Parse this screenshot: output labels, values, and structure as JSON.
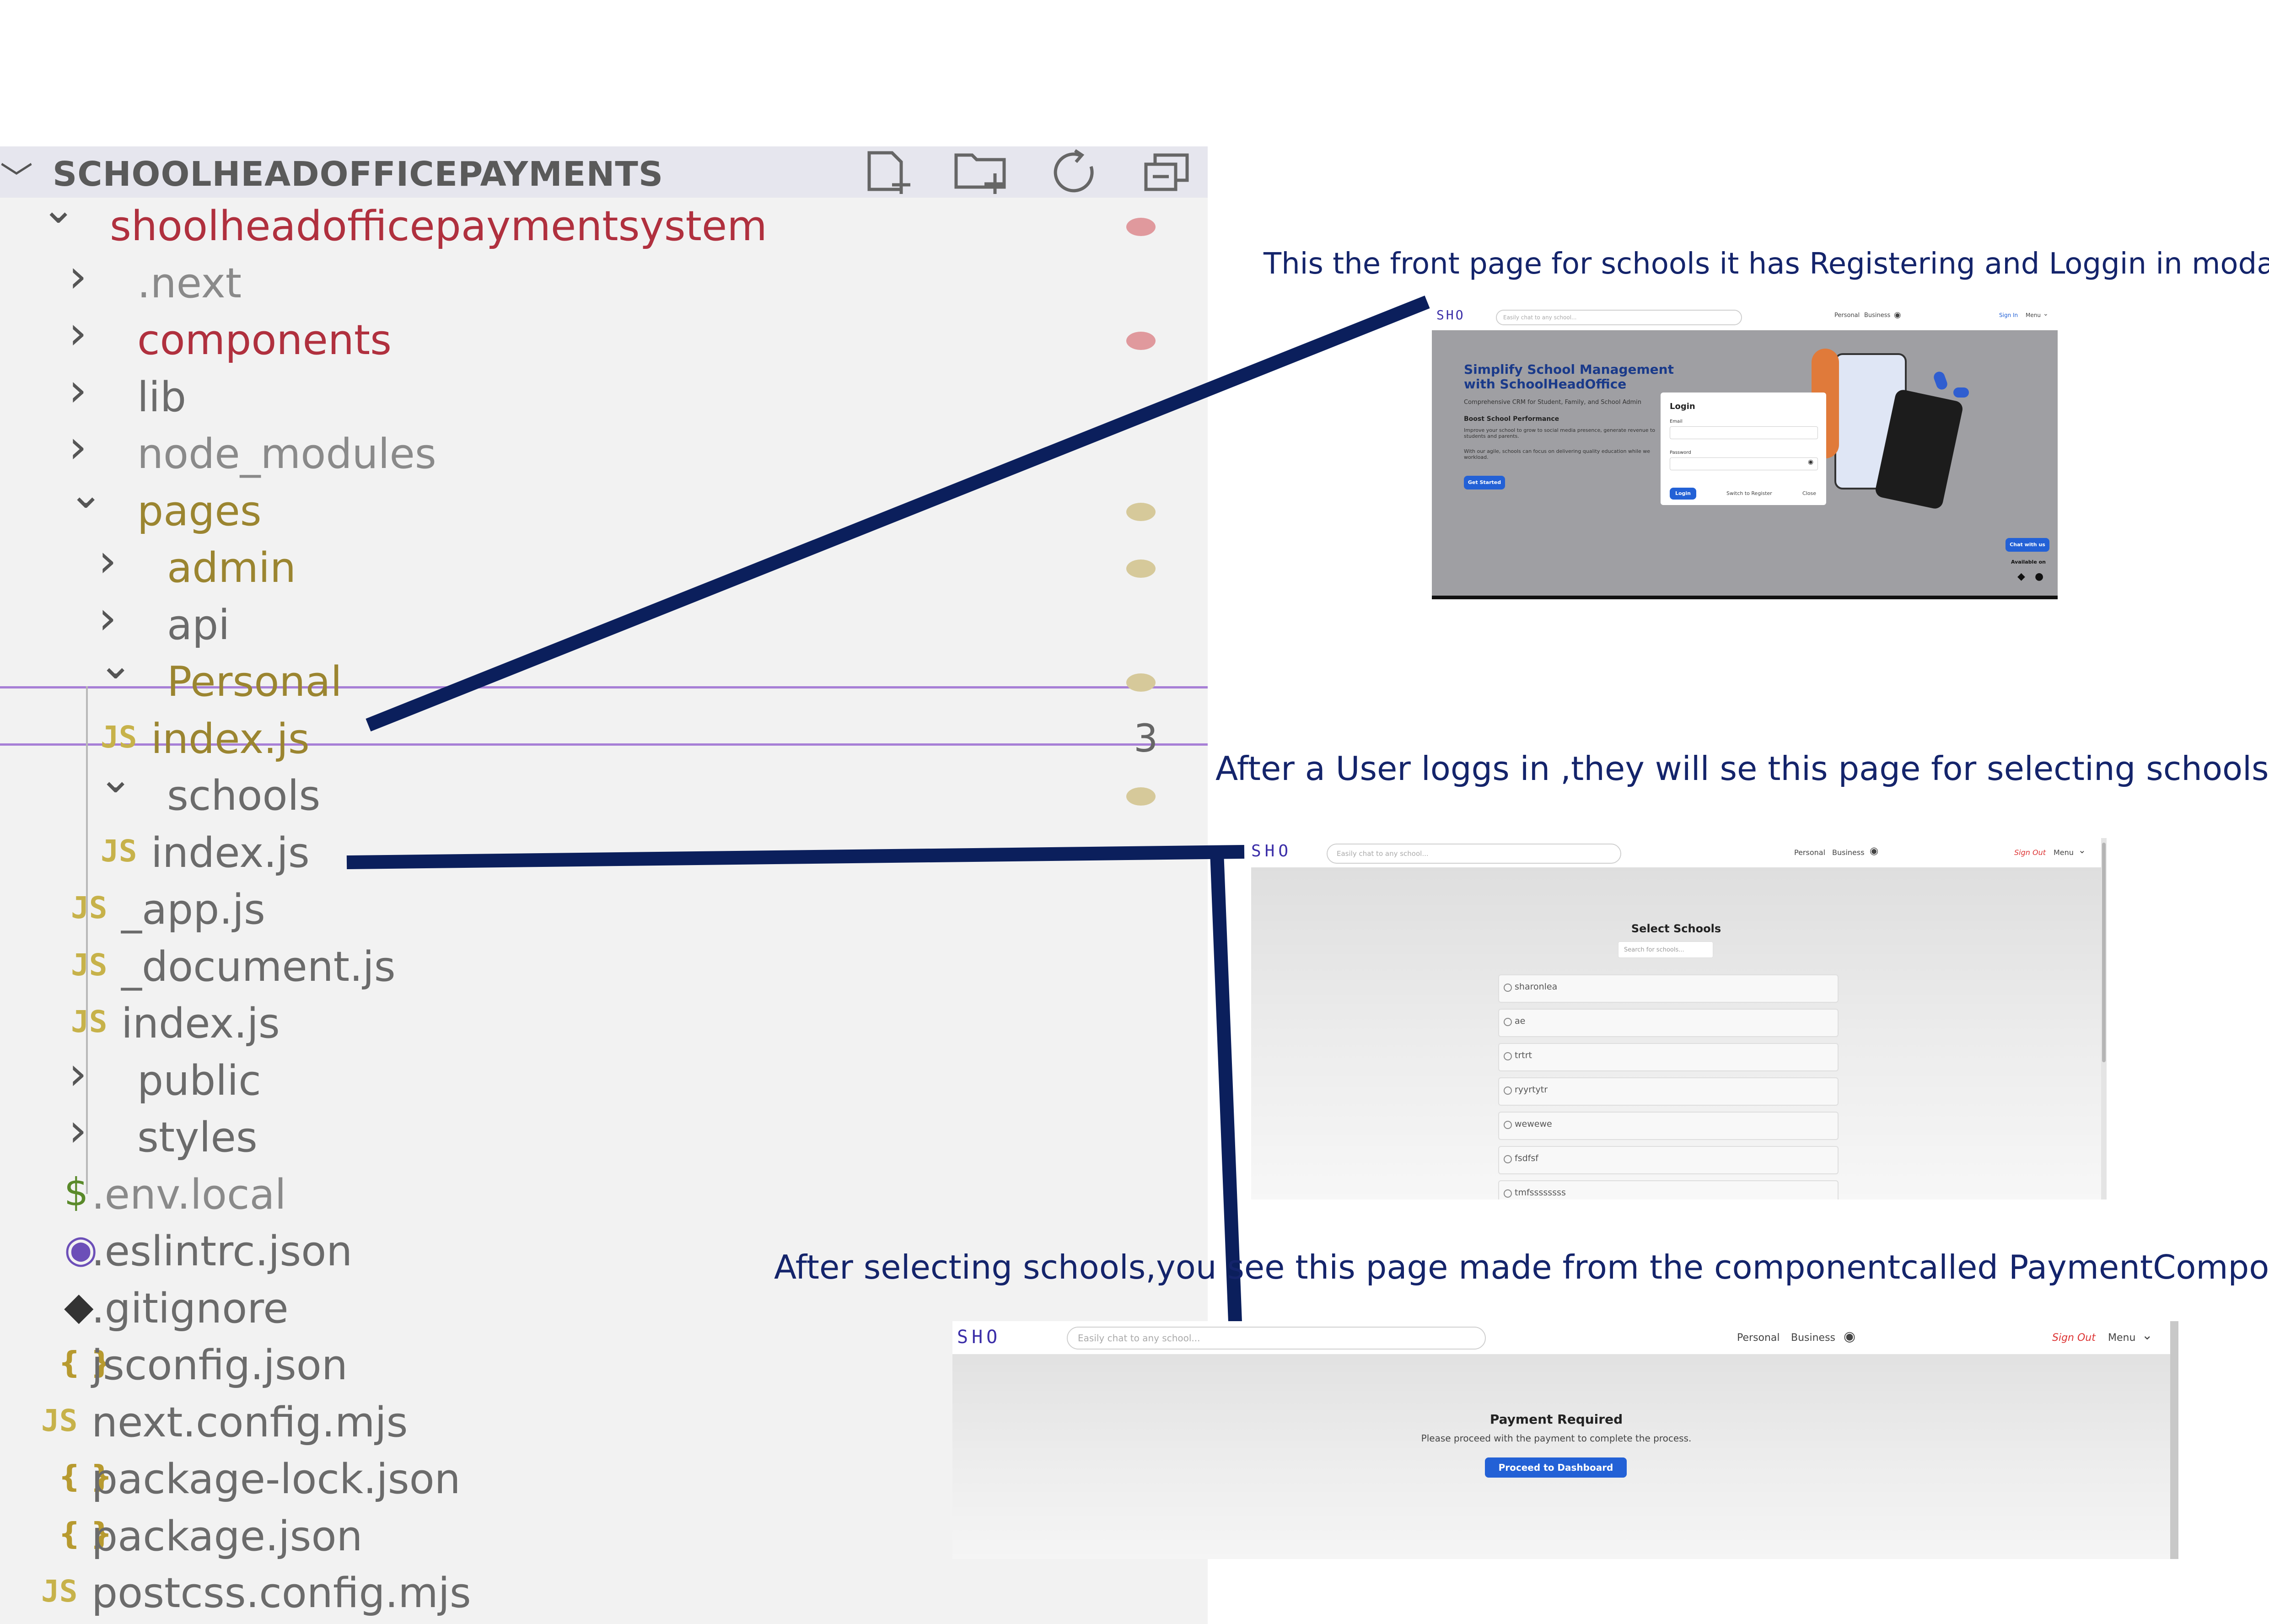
{
  "explorer": {
    "title": "SCHOOLHEADOFFICEPAYMENTS",
    "header_icons": [
      "new-file-icon",
      "new-folder-icon",
      "refresh-icon",
      "collapse-all-icon"
    ],
    "items": [
      {
        "label": "shoolheadofficepaymentsystem",
        "type": "folder",
        "expanded": true,
        "depth": 1,
        "color": "#b0303e",
        "dot": "#e0999d"
      },
      {
        "label": ".next",
        "type": "folder",
        "expanded": false,
        "depth": 2,
        "color": "#8a8a8a"
      },
      {
        "label": "components",
        "type": "folder",
        "expanded": false,
        "depth": 2,
        "color": "#b0303e",
        "dot": "#e0999d"
      },
      {
        "label": "lib",
        "type": "folder",
        "expanded": false,
        "depth": 2,
        "color": "#6b6b6b"
      },
      {
        "label": "node_modules",
        "type": "folder",
        "expanded": false,
        "depth": 2,
        "color": "#8a8a8a"
      },
      {
        "label": "pages",
        "type": "folder",
        "expanded": true,
        "depth": 2,
        "color": "#9b8530",
        "dot": "#d6c99a"
      },
      {
        "label": "admin",
        "type": "folder",
        "expanded": false,
        "depth": 3,
        "color": "#9b8530",
        "dot": "#d6c99a"
      },
      {
        "label": "api",
        "type": "folder",
        "expanded": false,
        "depth": 3,
        "color": "#6b6b6b"
      },
      {
        "label": "Personal",
        "type": "folder",
        "expanded": true,
        "depth": 3,
        "color": "#9b8530",
        "dot": "#d6c99a"
      },
      {
        "label": "index.js",
        "type": "js",
        "depth": 4,
        "color": "#9b8530",
        "count": "3"
      },
      {
        "label": "schools",
        "type": "folder",
        "expanded": true,
        "depth": 3,
        "color": "#6b6b6b",
        "dot": "#d6c99a"
      },
      {
        "label": "index.js",
        "type": "js",
        "depth": 4,
        "color": "#6b6b6b"
      },
      {
        "label": "_app.js",
        "type": "js",
        "depth": 3,
        "color": "#6b6b6b"
      },
      {
        "label": "_document.js",
        "type": "js",
        "depth": 3,
        "color": "#6b6b6b"
      },
      {
        "label": "index.js",
        "type": "js",
        "depth": 3,
        "color": "#6b6b6b"
      },
      {
        "label": "public",
        "type": "folder",
        "expanded": false,
        "depth": 2,
        "color": "#6b6b6b"
      },
      {
        "label": "styles",
        "type": "folder",
        "expanded": false,
        "depth": 2,
        "color": "#6b6b6b"
      },
      {
        "label": ".env.local",
        "type": "env",
        "depth": 2,
        "color": "#8a8a8a"
      },
      {
        "label": ".eslintrc.json",
        "type": "eslint",
        "depth": 2,
        "color": "#6b6b6b"
      },
      {
        "label": ".gitignore",
        "type": "git",
        "depth": 2,
        "color": "#6b6b6b"
      },
      {
        "label": "jsconfig.json",
        "type": "json",
        "depth": 2,
        "color": "#6b6b6b"
      },
      {
        "label": "next.config.mjs",
        "type": "js",
        "depth": 2,
        "color": "#6b6b6b"
      },
      {
        "label": "package-lock.json",
        "type": "json",
        "depth": 2,
        "color": "#6b6b6b"
      },
      {
        "label": "package.json",
        "type": "json",
        "depth": 2,
        "color": "#6b6b6b"
      },
      {
        "label": "postcss.config.mjs",
        "type": "js",
        "depth": 2,
        "color": "#6b6b6b"
      }
    ]
  },
  "annotations": {
    "front_page": "This the front page for schools it has Registering and Loggin in modal",
    "select_schools": "After a User loggs in ,they will se this page for selecting schools",
    "payment": "After selecting schools,you see this page made from the componentcalled PaymentComponent"
  },
  "screenshot1": {
    "logo": "SHO",
    "search_placeholder": "Easily chat to any school...",
    "nav": [
      "Personal",
      "Business"
    ],
    "sign_in": "Sign In",
    "menu": "Menu",
    "hero_title": "Simplify School Management with SchoolHeadOffice",
    "hero_sub": "Comprehensive CRM for Student, Family, and School Admin",
    "boost_title": "Boost School Performance",
    "boost_text_1": "Improve your school to grow to social media presence, generate revenue to students and parents.",
    "boost_text_2": "With our agile, schools can focus on delivering quality education while we workload.",
    "get_started": "Get Started",
    "modal_title": "Login",
    "email_label": "Email",
    "password_label": "Password",
    "login_button": "Login",
    "switch_register": "Switch to Register",
    "close": "Close",
    "chat_button": "Chat with us",
    "available_on": "Available on"
  },
  "screenshot2": {
    "logo": "SHO",
    "search_placeholder": "Easily chat to any school...",
    "nav": [
      "Personal",
      "Business"
    ],
    "sign_out": "Sign Out",
    "menu": "Menu",
    "title": "Select Schools",
    "search_schools_placeholder": "Search for schools...",
    "schools": [
      "sharonlea",
      "ae",
      "trtrt",
      "ryyrtytr",
      "wewewe",
      "fsdfsf",
      "tmfssssssss"
    ]
  },
  "screenshot3": {
    "logo": "SHO",
    "search_placeholder": "Easily chat to any school...",
    "nav": [
      "Personal",
      "Business"
    ],
    "sign_out": "Sign Out",
    "menu": "Menu",
    "title": "Payment Required",
    "subtitle": "Please proceed with the payment to complete the process.",
    "button": "Proceed to Dashboard"
  },
  "colors": {
    "annotation_text": "#14246b",
    "connector_line": "#0b1f5c",
    "accent_blue": "#2361d6",
    "logo_purple": "#3b2ea8",
    "sign_out_red": "#dd3333",
    "selection_border": "#a77fd6"
  }
}
